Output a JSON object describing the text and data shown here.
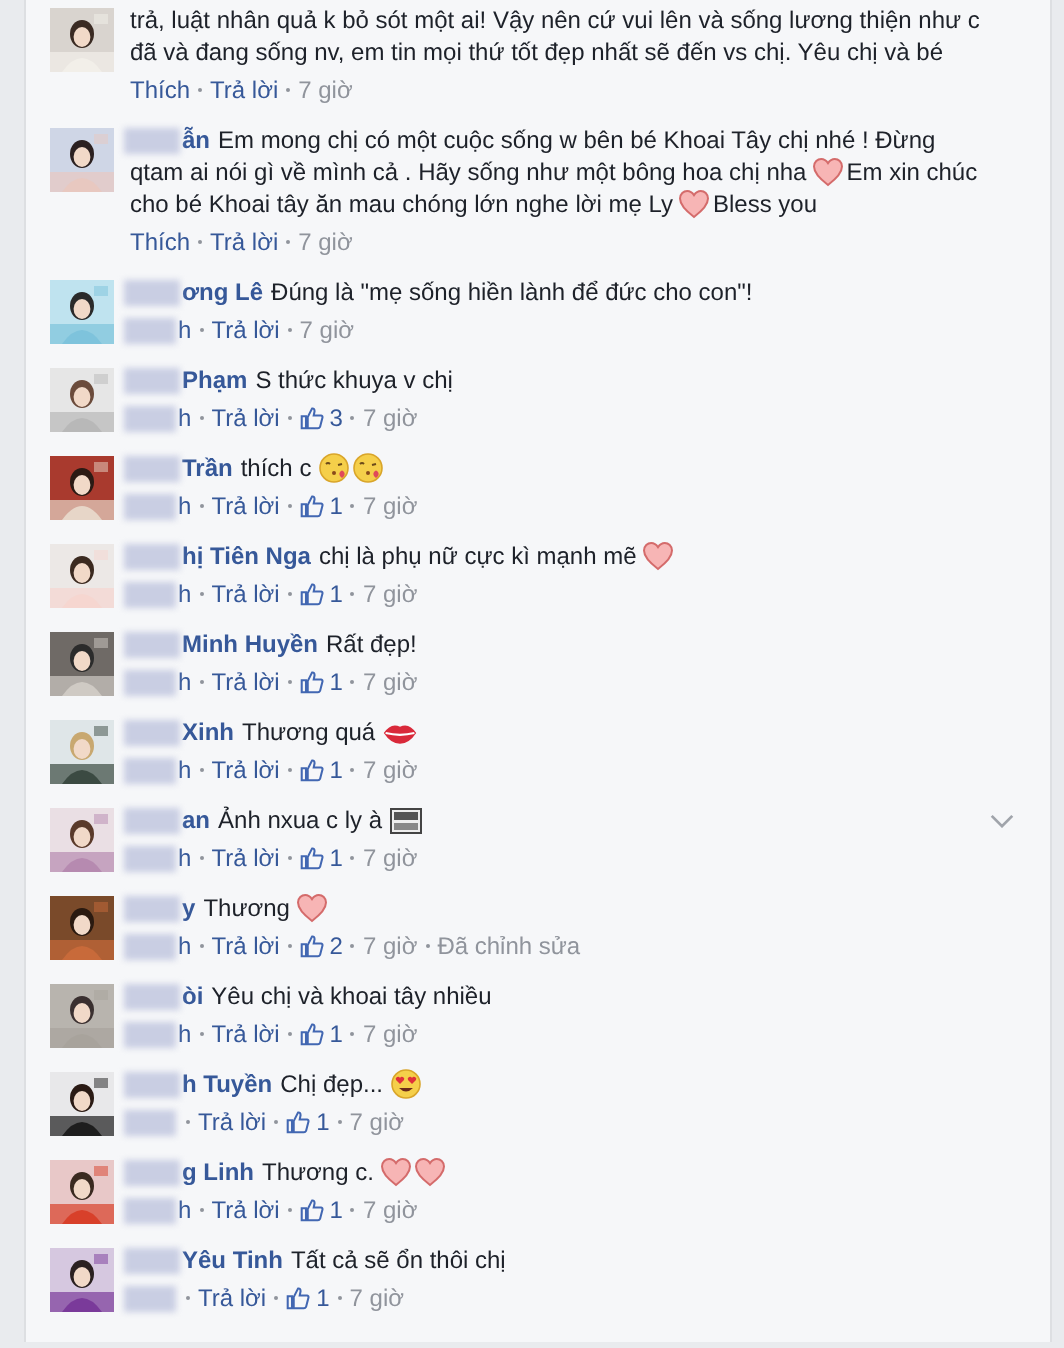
{
  "comments": [
    {
      "avatar": {
        "kind": "picture"
      },
      "name_redacted": false,
      "lines": [
        [
          {
            "kind": "text",
            "text": "trả, luật nhân quả k bỏ sót một ai! Vậy nên cứ vui lên và sống lương thiện như c"
          }
        ],
        [
          {
            "kind": "text",
            "text": "đã và đang sống nv, em tin mọi thứ tốt đẹp nhất sẽ đến vs chị. Yêu chị và bé"
          }
        ]
      ],
      "actions": [
        {
          "kind": "link",
          "text": "Thích",
          "redacted": false
        },
        {
          "kind": "link",
          "text": "Trả lời",
          "redacted": false
        },
        {
          "kind": "time",
          "text": "7 giờ",
          "redacted": false
        }
      ],
      "menu_chevron": false
    },
    {
      "avatar": {
        "kind": "picture"
      },
      "name": "ẫn",
      "name_redacted": true,
      "lines": [
        [
          {
            "kind": "text",
            "text": "Em mong chị có một cuộc sống w bên bé Khoai Tây chị nhé ! Đừng"
          }
        ],
        [
          {
            "kind": "text",
            "text": "qtam ai nói gì về mình cả . Hãy sống như một bông hoa chị nha"
          },
          {
            "kind": "heart"
          },
          {
            "kind": "text",
            "text": "Em xin chúc"
          }
        ],
        [
          {
            "kind": "text",
            "text": "cho bé Khoai tây ăn mau chóng lớn nghe lời mẹ Ly"
          },
          {
            "kind": "heart"
          },
          {
            "kind": "text",
            "text": "Bless you"
          }
        ]
      ],
      "actions": [
        {
          "kind": "link",
          "text": "Thích",
          "redacted": false
        },
        {
          "kind": "link",
          "text": "Trả lời",
          "redacted": false
        },
        {
          "kind": "time",
          "text": "7 giờ",
          "redacted": false
        }
      ],
      "menu_chevron": false
    },
    {
      "avatar": {
        "kind": "picture"
      },
      "name": "ơng Lê",
      "name_redacted": true,
      "lines": [
        [
          {
            "kind": "text",
            "text": "Đúng là \"mẹ sống hiền lành để đức cho con\"!"
          }
        ]
      ],
      "actions": [
        {
          "kind": "link",
          "text": "h",
          "redacted": true
        },
        {
          "kind": "link",
          "text": "Trả lời",
          "redacted": false
        },
        {
          "kind": "time",
          "text": "7 giờ",
          "redacted": false
        }
      ],
      "menu_chevron": false
    },
    {
      "avatar": {
        "kind": "picture"
      },
      "name": "Phạm",
      "name_redacted": true,
      "lines": [
        [
          {
            "kind": "text",
            "text": "S thức khuya v chị"
          }
        ]
      ],
      "actions": [
        {
          "kind": "link",
          "text": "h",
          "redacted": true
        },
        {
          "kind": "link",
          "text": "Trả lời",
          "redacted": false
        },
        {
          "kind": "likes",
          "text": "3",
          "redacted": false
        },
        {
          "kind": "time",
          "text": "7 giờ",
          "redacted": false
        }
      ],
      "menu_chevron": false
    },
    {
      "avatar": {
        "kind": "picture"
      },
      "name": "Trần",
      "name_redacted": true,
      "lines": [
        [
          {
            "kind": "text",
            "text": "thích c"
          },
          {
            "kind": "kiss"
          },
          {
            "kind": "kiss"
          }
        ]
      ],
      "actions": [
        {
          "kind": "link",
          "text": "h",
          "redacted": true
        },
        {
          "kind": "link",
          "text": "Trả lời",
          "redacted": false
        },
        {
          "kind": "likes",
          "text": "1",
          "redacted": false
        },
        {
          "kind": "time",
          "text": "7 giờ",
          "redacted": false
        }
      ],
      "menu_chevron": false
    },
    {
      "avatar": {
        "kind": "picture"
      },
      "name": "hị Tiên Nga",
      "name_redacted": true,
      "lines": [
        [
          {
            "kind": "text",
            "text": "chị là phụ nữ cực kì mạnh mẽ"
          },
          {
            "kind": "heart"
          }
        ]
      ],
      "actions": [
        {
          "kind": "link",
          "text": "h",
          "redacted": true
        },
        {
          "kind": "link",
          "text": "Trả lời",
          "redacted": false
        },
        {
          "kind": "likes",
          "text": "1",
          "redacted": false
        },
        {
          "kind": "time",
          "text": "7 giờ",
          "redacted": false
        }
      ],
      "menu_chevron": false
    },
    {
      "avatar": {
        "kind": "picture"
      },
      "name": "Minh Huyền",
      "name_redacted": true,
      "lines": [
        [
          {
            "kind": "text",
            "text": "Rất đẹp!"
          }
        ]
      ],
      "actions": [
        {
          "kind": "link",
          "text": "h",
          "redacted": true
        },
        {
          "kind": "link",
          "text": "Trả lời",
          "redacted": false
        },
        {
          "kind": "likes",
          "text": "1",
          "redacted": false
        },
        {
          "kind": "time",
          "text": "7 giờ",
          "redacted": false
        }
      ],
      "menu_chevron": false
    },
    {
      "avatar": {
        "kind": "picture"
      },
      "name": "Xinh",
      "name_redacted": true,
      "lines": [
        [
          {
            "kind": "text",
            "text": "Thương quá"
          },
          {
            "kind": "lips"
          }
        ]
      ],
      "actions": [
        {
          "kind": "link",
          "text": "h",
          "redacted": true
        },
        {
          "kind": "link",
          "text": "Trả lời",
          "redacted": false
        },
        {
          "kind": "likes",
          "text": "1",
          "redacted": false
        },
        {
          "kind": "time",
          "text": "7 giờ",
          "redacted": false
        }
      ],
      "menu_chevron": false
    },
    {
      "avatar": {
        "kind": "picture"
      },
      "name": "an",
      "name_redacted": true,
      "lines": [
        [
          {
            "kind": "text",
            "text": "Ảnh nxua c ly à"
          },
          {
            "kind": "vip"
          }
        ]
      ],
      "actions": [
        {
          "kind": "link",
          "text": "h",
          "redacted": true
        },
        {
          "kind": "link",
          "text": "Trả lời",
          "redacted": false
        },
        {
          "kind": "likes",
          "text": "1",
          "redacted": false
        },
        {
          "kind": "time",
          "text": "7 giờ",
          "redacted": false
        }
      ],
      "menu_chevron": true
    },
    {
      "avatar": {
        "kind": "picture"
      },
      "name": "y",
      "name_redacted": true,
      "lines": [
        [
          {
            "kind": "text",
            "text": "Thương"
          },
          {
            "kind": "heart"
          }
        ]
      ],
      "actions": [
        {
          "kind": "link",
          "text": "h",
          "redacted": true
        },
        {
          "kind": "link",
          "text": "Trả lời",
          "redacted": false
        },
        {
          "kind": "likes",
          "text": "2",
          "redacted": false
        },
        {
          "kind": "time",
          "text": "7 giờ",
          "redacted": false
        },
        {
          "kind": "note",
          "text": "Đã chỉnh sửa",
          "redacted": false
        }
      ],
      "menu_chevron": false
    },
    {
      "avatar": {
        "kind": "picture"
      },
      "name": "òi",
      "name_redacted": true,
      "lines": [
        [
          {
            "kind": "text",
            "text": "Yêu chị và khoai tây nhiều"
          }
        ]
      ],
      "actions": [
        {
          "kind": "link",
          "text": "h",
          "redacted": true
        },
        {
          "kind": "link",
          "text": "Trả lời",
          "redacted": false
        },
        {
          "kind": "likes",
          "text": "1",
          "redacted": false
        },
        {
          "kind": "time",
          "text": "7 giờ",
          "redacted": false
        }
      ],
      "menu_chevron": false
    },
    {
      "avatar": {
        "kind": "picture"
      },
      "name": "h Tuyền",
      "name_redacted": true,
      "lines": [
        [
          {
            "kind": "text",
            "text": "Chị đẹp..."
          },
          {
            "kind": "hearteyes"
          }
        ]
      ],
      "actions": [
        {
          "kind": "link",
          "redacted": true
        },
        {
          "kind": "link",
          "text": "Trả lời",
          "redacted": false
        },
        {
          "kind": "likes",
          "text": "1",
          "redacted": false
        },
        {
          "kind": "time",
          "text": "7 giờ",
          "redacted": false
        }
      ],
      "menu_chevron": false
    },
    {
      "avatar": {
        "kind": "picture"
      },
      "name": "g Linh",
      "name_redacted": true,
      "lines": [
        [
          {
            "kind": "text",
            "text": "Thương c."
          },
          {
            "kind": "heart"
          },
          {
            "kind": "heart"
          }
        ]
      ],
      "actions": [
        {
          "kind": "link",
          "text": "h",
          "redacted": true
        },
        {
          "kind": "link",
          "text": "Trả lời",
          "redacted": false
        },
        {
          "kind": "likes",
          "text": "1",
          "redacted": false
        },
        {
          "kind": "time",
          "text": "7 giờ",
          "redacted": false
        }
      ],
      "menu_chevron": false
    },
    {
      "avatar": {
        "kind": "picture"
      },
      "name": "Yêu Tinh",
      "name_redacted": true,
      "lines": [
        [
          {
            "kind": "text",
            "text": "Tất cả sẽ ổn thôi chị"
          }
        ]
      ],
      "actions": [
        {
          "kind": "link",
          "redacted": true
        },
        {
          "kind": "link",
          "text": "Trả lời",
          "redacted": false
        },
        {
          "kind": "likes",
          "text": "1",
          "redacted": false
        },
        {
          "kind": "time",
          "text": "7 giờ",
          "redacted": false
        }
      ],
      "menu_chevron": false
    }
  ]
}
